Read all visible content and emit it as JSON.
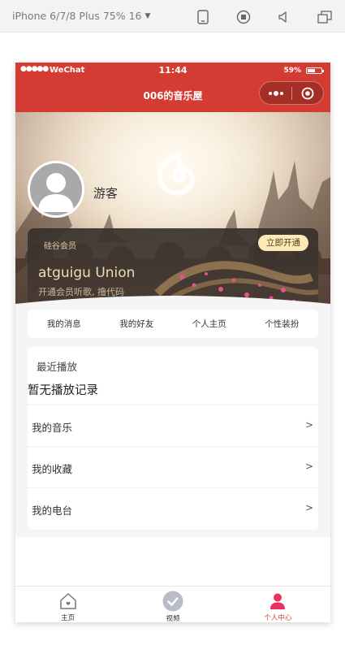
{
  "devtools": {
    "device_label": "iPhone 6/7/8 Plus 75% 16",
    "icons": [
      "phone-icon",
      "record-icon",
      "volume-icon",
      "window-icon"
    ]
  },
  "status_bar": {
    "signal": "●●●●●",
    "carrier": "WeChat",
    "time": "11:44",
    "battery_pct": "59%",
    "battery_level": 0.59
  },
  "nav": {
    "title": "006的音乐屋"
  },
  "user": {
    "name": "游客"
  },
  "vip": {
    "label": "硅谷会员",
    "button": "立即开通",
    "title": "atguigu Union",
    "subtitle": "开通会员听歌, 撸代码"
  },
  "menu": [
    {
      "label": "我的消息"
    },
    {
      "label": "我的好友"
    },
    {
      "label": "个人主页"
    },
    {
      "label": "个性装扮"
    }
  ],
  "recent": {
    "title": "最近播放",
    "empty_text": "暂无播放记录"
  },
  "rows": [
    {
      "label": "我的音乐",
      "arrow": ">"
    },
    {
      "label": "我的收藏",
      "arrow": ">"
    },
    {
      "label": "我的电台",
      "arrow": ">"
    }
  ],
  "tabs": [
    {
      "label": "主页",
      "icon": "home-icon",
      "active": false
    },
    {
      "label": "视频",
      "icon": "check-circle-icon",
      "active": false
    },
    {
      "label": "个人中心",
      "icon": "person-icon",
      "active": true
    }
  ],
  "colors": {
    "brand": "#d43c33",
    "vip_button": "#fde9b6",
    "tab_active": "#d43c33"
  }
}
